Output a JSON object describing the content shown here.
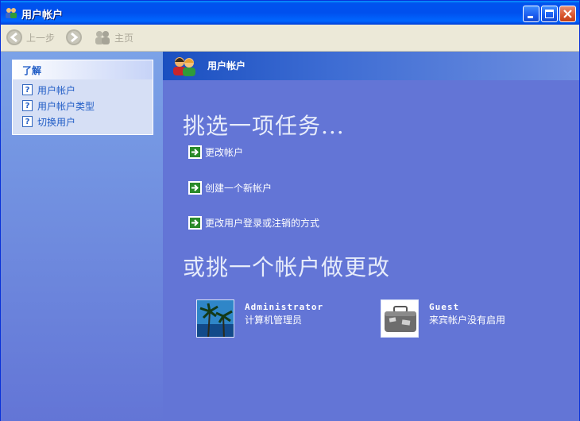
{
  "window": {
    "title": "用户帐户"
  },
  "toolbar": {
    "back_label": "上一步",
    "home_label": "主页"
  },
  "learn_panel": {
    "header": "了解",
    "items": [
      {
        "label": "用户帐户"
      },
      {
        "label": "用户帐户类型"
      },
      {
        "label": "切换用户"
      }
    ]
  },
  "banner": {
    "title": "用户帐户"
  },
  "tasks": {
    "heading": "挑选一项任务...",
    "items": [
      {
        "label": "更改帐户"
      },
      {
        "label": "创建一个新帐户"
      },
      {
        "label": "更改用户登录或注销的方式"
      }
    ]
  },
  "accounts": {
    "heading": "或挑一个帐户做更改",
    "items": [
      {
        "name": "Administrator",
        "description": "计算机管理员",
        "picture": "palm-trees-picture"
      },
      {
        "name": "Guest",
        "description": "来宾帐户没有启用",
        "picture": "briefcase-picture"
      }
    ]
  },
  "colors": {
    "panel_blue": "#6375d6",
    "title_blue": "#0053ee",
    "link_blue": "#215dc6"
  }
}
